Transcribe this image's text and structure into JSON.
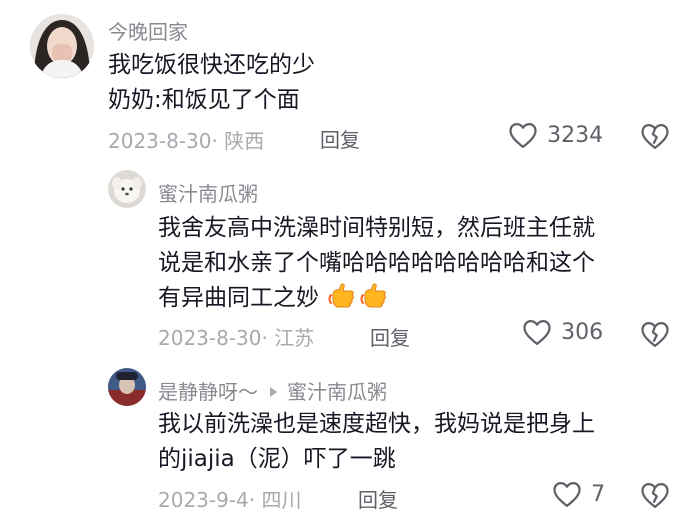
{
  "comments": [
    {
      "user": "今晚回家",
      "lines": [
        "我吃饭很快还吃的少",
        "奶奶:和饭见了个面"
      ],
      "date": "2023-8-30",
      "location": "陕西",
      "reply_label": "回复",
      "likes": "3234"
    },
    {
      "user": "蜜汁南瓜粥",
      "lines": [
        "我舍友高中洗澡时间特别短，然后班主任就",
        "说是和水亲了个嘴哈哈哈哈哈哈哈哈和这个",
        "有异曲同工之妙"
      ],
      "date": "2023-8-30",
      "location": "江苏",
      "reply_label": "回复",
      "likes": "306"
    },
    {
      "user": "是静静呀～",
      "reply_to": "蜜汁南瓜粥",
      "lines": [
        "我以前洗澡也是速度超快，我妈说是把身上",
        "的jiajia（泥）吓了一跳"
      ],
      "date": "2023-9-4",
      "location": "四川",
      "reply_label": "回复",
      "likes": "7"
    }
  ],
  "icons": {
    "like": "heart-outline-icon",
    "dislike": "broken-heart-icon",
    "emoji": "thumbs-up-hand-emoji"
  },
  "colors": {
    "text": "#161823",
    "username": "#8a8b91",
    "meta": "#a8a9ae",
    "action": "#5f6068"
  }
}
